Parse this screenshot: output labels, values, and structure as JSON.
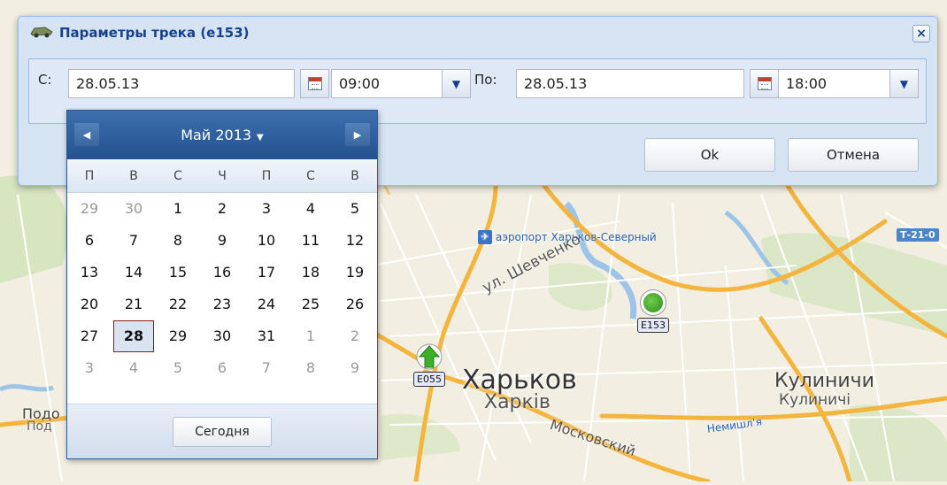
{
  "map": {
    "city_name": "Харьков",
    "city_name_uk": "Харків",
    "town_name": "Кулиничи",
    "town_name_uk": "Кулиничі",
    "podgorod_main": "Подо",
    "podgorod_sub": "Под",
    "airport_label": "аэропорт Харьков-Северный",
    "street_shevchenko": "ул. Шевченко",
    "street_moskovsky": "Московский",
    "street_nemyshlyanska": "Немишл'я",
    "road_badge": "Т-21-0",
    "markers": [
      {
        "label": "E153",
        "icon": "green-dot-icon"
      },
      {
        "label": "E055",
        "icon": "green-arrow-up-icon"
      }
    ]
  },
  "dialog": {
    "title": "Параметры трека (e153)",
    "title_icon": "vehicle-icon",
    "close_label": "×",
    "from_label": "С:",
    "from_date": "28.05.13",
    "from_time": "09:00",
    "to_label": "По:",
    "to_date": "28.05.13",
    "to_time": "18:00",
    "ok_label": "Ok",
    "cancel_label": "Отмена"
  },
  "datepicker": {
    "month_label": "Май 2013",
    "prev_glyph": "◀",
    "next_glyph": "▶",
    "weekdays": [
      "П",
      "В",
      "С",
      "Ч",
      "П",
      "С",
      "В"
    ],
    "today_label": "Сегодня",
    "selected_day": 28,
    "weeks": [
      [
        {
          "d": "29",
          "o": true
        },
        {
          "d": "30",
          "o": true
        },
        {
          "d": "1"
        },
        {
          "d": "2"
        },
        {
          "d": "3"
        },
        {
          "d": "4"
        },
        {
          "d": "5"
        }
      ],
      [
        {
          "d": "6"
        },
        {
          "d": "7"
        },
        {
          "d": "8"
        },
        {
          "d": "9"
        },
        {
          "d": "10"
        },
        {
          "d": "11"
        },
        {
          "d": "12"
        }
      ],
      [
        {
          "d": "13"
        },
        {
          "d": "14"
        },
        {
          "d": "15"
        },
        {
          "d": "16"
        },
        {
          "d": "17"
        },
        {
          "d": "18"
        },
        {
          "d": "19"
        }
      ],
      [
        {
          "d": "20"
        },
        {
          "d": "21"
        },
        {
          "d": "22"
        },
        {
          "d": "23"
        },
        {
          "d": "24"
        },
        {
          "d": "25"
        },
        {
          "d": "26"
        }
      ],
      [
        {
          "d": "27"
        },
        {
          "d": "28",
          "s": true
        },
        {
          "d": "29"
        },
        {
          "d": "30"
        },
        {
          "d": "31"
        },
        {
          "d": "1",
          "o": true
        },
        {
          "d": "2",
          "o": true
        }
      ],
      [
        {
          "d": "3",
          "o": true
        },
        {
          "d": "4",
          "o": true
        },
        {
          "d": "5",
          "o": true
        },
        {
          "d": "6",
          "o": true
        },
        {
          "d": "7",
          "o": true
        },
        {
          "d": "8",
          "o": true
        },
        {
          "d": "9",
          "o": true
        }
      ]
    ]
  }
}
